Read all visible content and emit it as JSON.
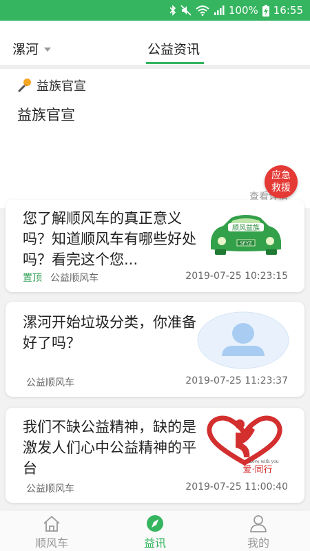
{
  "status_bar": {
    "battery": "100%",
    "time": "16:55"
  },
  "header": {
    "city": "漯河",
    "tab": "公益资讯"
  },
  "notice": {
    "tag": "益族官宣",
    "content": "益族官宣",
    "more": "查看详情"
  },
  "emergency": {
    "line1": "应急",
    "line2": "救援"
  },
  "articles": [
    {
      "title": "您了解顺风车的真正意义吗？知道顺风车有哪些好处吗？看完这个您...",
      "pinned": "置顶",
      "source": "公益顺风车",
      "time": "2019-07-25 10:23:15",
      "logo_text": "顺风益族",
      "plate": "SFYZ"
    },
    {
      "title": "漯河开始垃圾分类，你准备好了吗？",
      "source": "公益顺风车",
      "time": "2019-07-25 11:23:37"
    },
    {
      "title": "我们不缺公益精神，缺的是激发人们心中公益精神的平台",
      "source": "公益顺风车",
      "time": "2019-07-25 11:00:40",
      "logo_caption": "Love with you",
      "logo_text": "爱·同行"
    }
  ],
  "bottom_nav": [
    {
      "label": "顺风车"
    },
    {
      "label": "益讯"
    },
    {
      "label": "我的"
    }
  ],
  "colors": {
    "accent": "#35b55f",
    "emergency": "#e53935"
  }
}
